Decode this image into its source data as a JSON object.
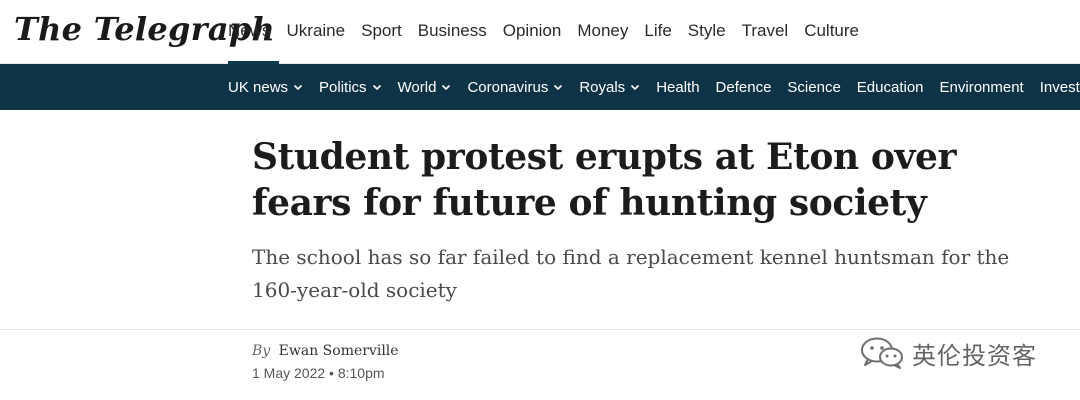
{
  "masthead": {
    "logo_text": "The Telegraph",
    "primary_nav": [
      "News",
      "Ukraine",
      "Sport",
      "Business",
      "Opinion",
      "Money",
      "Life",
      "Style",
      "Travel",
      "Culture"
    ],
    "active_section": "News"
  },
  "secondary_nav": [
    {
      "label": "UK news",
      "has_dropdown": true
    },
    {
      "label": "Politics",
      "has_dropdown": true
    },
    {
      "label": "World",
      "has_dropdown": true
    },
    {
      "label": "Coronavirus",
      "has_dropdown": true
    },
    {
      "label": "Royals",
      "has_dropdown": true
    },
    {
      "label": "Health",
      "has_dropdown": false
    },
    {
      "label": "Defence",
      "has_dropdown": false
    },
    {
      "label": "Science",
      "has_dropdown": false
    },
    {
      "label": "Education",
      "has_dropdown": false
    },
    {
      "label": "Environment",
      "has_dropdown": false
    },
    {
      "label": "Investigations",
      "has_dropdown": false
    }
  ],
  "article": {
    "headline": "Student protest erupts at Eton over fears for future of hunting society",
    "standfirst": "The school has so far failed to find a replacement kennel huntsman for the 160-year-old society",
    "byline_prefix": "By",
    "author": "Ewan Somerville",
    "date": "1 May 2022 • 8:10pm"
  },
  "watermark": {
    "text": "英伦投资客",
    "icon": "wechat-icon"
  },
  "colors": {
    "secondary_nav_bg": "#0e3347",
    "text": "#1c1c1c"
  }
}
